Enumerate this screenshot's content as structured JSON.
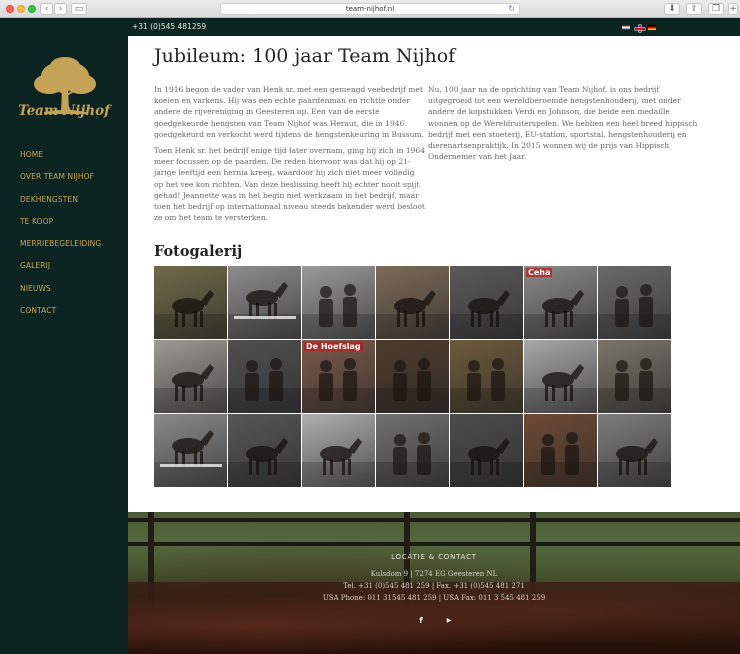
{
  "browser": {
    "url": "team-nijhof.nl",
    "back_glyph": "‹",
    "forward_glyph": "›",
    "reload_glyph": "↻"
  },
  "topbar": {
    "phone": "+31 (0)545 481259",
    "flags": [
      "nl-flag-icon",
      "uk-flag-icon",
      "de-flag-icon"
    ]
  },
  "sidebar": {
    "logo_text": "Team Nijhof",
    "nav": [
      "HOME",
      "OVER TEAM NIJHOF",
      "DEKHENGSTEN",
      "TE KOOP",
      "MERRIEBEGELEIDING",
      "GALERIJ",
      "NIEUWS",
      "CONTACT"
    ]
  },
  "main": {
    "title": "Jubileum: 100 jaar Team Nijhof",
    "left_paragraphs": [
      "In 1916 begon de vader van Henk sr. met een gemengd veebedrijf met koeien en varkens. Hij was een echte paardenman en richtte onder andere de rijvereniging in Geesteren op. Een van de eerste goedgekeurde hengsten van Team Nijhof was Heraut, die in 1946 goedgekeurd en verkocht werd tijdens de hengstenkeuring in Bussum.",
      "Toen Henk sr. het bedrijf enige tijd later overnam, ging hij zich in 1964 meer focussen op de paarden. De reden hiervoor was dat hij op 21-jarige leeftijd een hernia kreeg, waardoor hij zich niet meer volledig op het vee kon richten. Van deze beslissing heeft hij echter nooit spijt gehad! Jeannette was in het begin niet werkzaam in het bedrijf, maar toen het bedrijf op internationaal niveau steeds bekender werd besloot ze om het team te versterken."
    ],
    "right_paragraphs": [
      "Nu, 100 jaar na de oprichting van Team Nijhof, is ons bedrijf uitgegroeid tot een wereldberoemde hengstenhouderij, met onder andere de kopstukken Verdi en Johnson, die beide een medaille wonnen op de Wereldruiterspelen. We hebben een heel breed hippisch bedrijf met een stoeterij, EU-station, sportstal, hengstenhouderij en dierenartsenpraktijk. In 2015 wonnen wij de prijs van Hippisch Ondernemer van het Jaar."
    ],
    "gallery_title": "Fotogalerij",
    "gallery": [
      {
        "tone": "#6f6a48",
        "sign": "",
        "subject": "horse"
      },
      {
        "tone": "#8d8d8d",
        "sign": "",
        "subject": "jump"
      },
      {
        "tone": "#9a9a9a",
        "sign": "",
        "subject": "people"
      },
      {
        "tone": "#7d6a58",
        "sign": "",
        "subject": "horse"
      },
      {
        "tone": "#5a5a5a",
        "sign": "",
        "subject": "horse"
      },
      {
        "tone": "#8a8a8a",
        "sign": "Ceha",
        "subject": "horse"
      },
      {
        "tone": "#6a6a6a",
        "sign": "",
        "subject": "people"
      },
      {
        "tone": "#9e9a94",
        "sign": "",
        "subject": "horse"
      },
      {
        "tone": "#505050",
        "sign": "",
        "subject": "people"
      },
      {
        "tone": "#7a5a4a",
        "sign": "De Hoefslag",
        "subject": "people"
      },
      {
        "tone": "#4e3a2c",
        "sign": "",
        "subject": "people"
      },
      {
        "tone": "#6d5a3a",
        "sign": "",
        "subject": "people"
      },
      {
        "tone": "#a8a8a8",
        "sign": "",
        "subject": "horse"
      },
      {
        "tone": "#7a7468",
        "sign": "",
        "subject": "people"
      },
      {
        "tone": "#8a8a8a",
        "sign": "",
        "subject": "jump"
      },
      {
        "tone": "#565656",
        "sign": "",
        "subject": "horse"
      },
      {
        "tone": "#b0b0b0",
        "sign": "",
        "subject": "horse"
      },
      {
        "tone": "#707070",
        "sign": "",
        "subject": "people"
      },
      {
        "tone": "#4c4c4c",
        "sign": "",
        "subject": "horse"
      },
      {
        "tone": "#6e4a34",
        "sign": "",
        "subject": "people"
      },
      {
        "tone": "#7c7c7c",
        "sign": "",
        "subject": "horse"
      }
    ]
  },
  "footer": {
    "heading": "LOCATIE & CONTACT",
    "lines": [
      "Kulsdom 9 | 7274 EG Geesteren NL",
      "Tel. +31 (0)545 481 259 | Fax. +31 (0)545 481 271",
      "USA Phone: 011 31545 481 259 | USA Fax: 011 3 545 481 259"
    ],
    "social": [
      {
        "name": "facebook-icon",
        "glyph": "f"
      },
      {
        "name": "youtube-icon",
        "glyph": "▶"
      }
    ]
  }
}
